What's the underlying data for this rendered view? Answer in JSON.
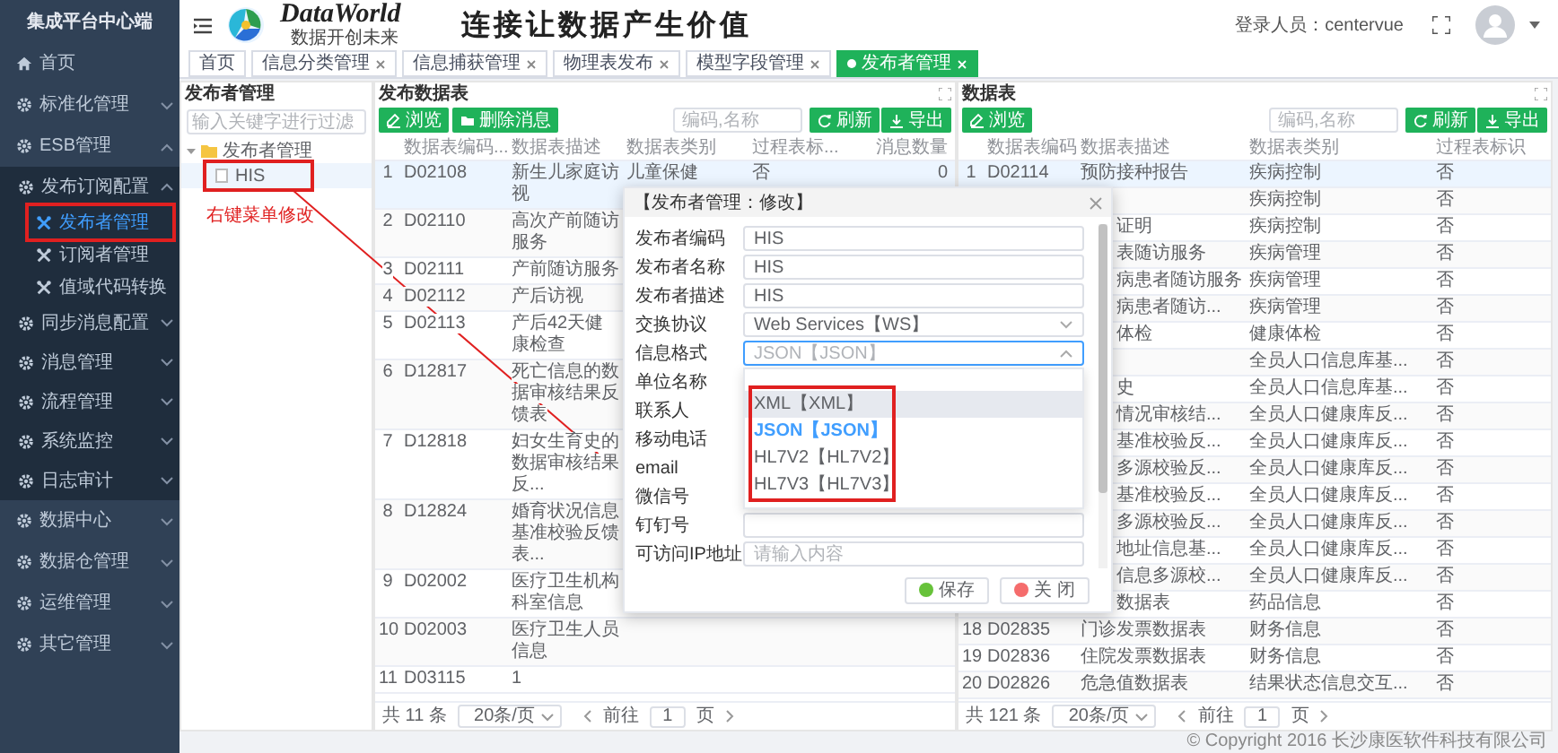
{
  "sidebar": {
    "title": "集成平台中心端",
    "items": [
      {
        "label": "首页"
      },
      {
        "label": "标准化管理",
        "expanded": false
      },
      {
        "label": "ESB管理",
        "expanded": true,
        "children": [
          {
            "label": "发布订阅配置",
            "expanded": true,
            "children": [
              {
                "label": "发布者管理",
                "selected": true,
                "annotated": true
              },
              {
                "label": "订阅者管理",
                "selected": false
              },
              {
                "label": "值域代码转换",
                "selected": false
              }
            ]
          },
          {
            "label": "同步消息配置",
            "expanded": false
          },
          {
            "label": "消息管理",
            "expanded": false
          },
          {
            "label": "流程管理",
            "expanded": false
          },
          {
            "label": "系统监控",
            "expanded": false
          },
          {
            "label": "日志审计",
            "expanded": false
          }
        ]
      },
      {
        "label": "数据中心",
        "expanded": false
      },
      {
        "label": "数据仓管理",
        "expanded": false
      },
      {
        "label": "运维管理",
        "expanded": false
      },
      {
        "label": "其它管理",
        "expanded": false
      }
    ]
  },
  "header": {
    "logo": {
      "name": "DataWorld",
      "tagline": "数据开创未来"
    },
    "slogan": "连接让数据产生价值",
    "user": "登录人员：centervue"
  },
  "tabs": [
    {
      "label": "首页",
      "closable": false,
      "selected": false
    },
    {
      "label": "信息分类管理",
      "closable": true,
      "selected": false
    },
    {
      "label": "信息捕获管理",
      "closable": true,
      "selected": false
    },
    {
      "label": "物理表发布",
      "closable": true,
      "selected": false
    },
    {
      "label": "模型字段管理",
      "closable": true,
      "selected": false
    },
    {
      "label": "发布者管理",
      "closable": true,
      "selected": true
    }
  ],
  "publisher_tree": {
    "title": "发布者管理",
    "filter_placeholder": "输入关键字进行过滤",
    "nodes": [
      {
        "label": "发布者管理",
        "expanded": true,
        "children": [
          {
            "label": "HIS",
            "selected": true,
            "annotated": true
          }
        ]
      }
    ],
    "annotation": {
      "text": "右键菜单修改"
    }
  },
  "publish_tables": {
    "title": "发布数据表",
    "actions": [
      {
        "label": "浏览",
        "kind": "browse"
      },
      {
        "label": "删除消息",
        "kind": "delete"
      }
    ],
    "search_placeholder": "编码,名称",
    "tools": [
      {
        "label": "刷新",
        "kind": "refresh"
      },
      {
        "label": "导出",
        "kind": "export"
      }
    ],
    "columns": [
      "数据表编码...",
      "数据表描述",
      "数据表类别",
      "过程表标...",
      "消息数量"
    ],
    "rows": [
      {
        "index": "1",
        "code": "D02108",
        "desc": "新生儿家庭访视",
        "category": "儿童保健",
        "process": "否",
        "count": "0",
        "selected": true
      },
      {
        "index": "2",
        "code": "D02110",
        "desc": "高次产前随访服务",
        "selected": false
      },
      {
        "index": "3",
        "code": "D02111",
        "desc": "产前随访服务",
        "selected": false
      },
      {
        "index": "4",
        "code": "D02112",
        "desc": "产后访视",
        "selected": false
      },
      {
        "index": "5",
        "code": "D02113",
        "desc": "产后42天健康检查",
        "selected": false
      },
      {
        "index": "6",
        "code": "D12817",
        "desc": "死亡信息的数据审核结果反馈表",
        "selected": false
      },
      {
        "index": "7",
        "code": "D12818",
        "desc": "妇女生育史的数据审核结果反...",
        "selected": false
      },
      {
        "index": "8",
        "code": "D12824",
        "desc": "婚育状况信息基准校验反馈表...",
        "selected": false
      },
      {
        "index": "9",
        "code": "D02002",
        "desc": "医疗卫生机构科室信息",
        "selected": false
      },
      {
        "index": "10",
        "code": "D02003",
        "desc": "医疗卫生人员信息",
        "selected": false
      },
      {
        "index": "11",
        "code": "D03115",
        "desc": "1",
        "selected": false
      }
    ],
    "pager": {
      "total": "共 11 条",
      "page_size": "20条/页",
      "goto": "前往",
      "page": "1",
      "unit": "页"
    }
  },
  "tables": {
    "title": "数据表",
    "actions": [
      {
        "label": "浏览",
        "kind": "browse"
      }
    ],
    "search_placeholder": "编码,名称",
    "tools": [
      {
        "label": "刷新",
        "kind": "refresh"
      },
      {
        "label": "导出",
        "kind": "export"
      }
    ],
    "columns": [
      "数据表编码",
      "数据表描述",
      "数据表类别",
      "过程表标识"
    ],
    "rows": [
      {
        "index": "1",
        "code": "D02114",
        "desc": "预防接种报告",
        "category": "疾病控制",
        "process": "否",
        "selected": true
      },
      {
        "category": "疾病控制",
        "process": "否",
        "selected": false
      },
      {
        "desc": "证明",
        "category": "疾病控制",
        "process": "否",
        "selected": false
      },
      {
        "desc": "表随访服务",
        "category": "疾病管理",
        "process": "否",
        "selected": false
      },
      {
        "desc": "病患者随访服务",
        "category": "疾病管理",
        "process": "否",
        "selected": false
      },
      {
        "desc": "病患者随访...",
        "category": "疾病管理",
        "process": "否",
        "selected": false
      },
      {
        "desc": "体检",
        "category": "健康体检",
        "process": "否",
        "selected": false
      },
      {
        "category": "全员人口信息库基...",
        "process": "否",
        "selected": false
      },
      {
        "desc": "史",
        "category": "全员人口信息库基...",
        "process": "否",
        "selected": false
      },
      {
        "desc": "情况审核结...",
        "category": "全员人口健康库反...",
        "process": "否",
        "selected": false
      },
      {
        "desc": "基准校验反...",
        "category": "全员人口健康库反...",
        "process": "否",
        "selected": false
      },
      {
        "desc": "多源校验反...",
        "category": "全员人口健康库反...",
        "process": "否",
        "selected": false
      },
      {
        "desc": "基准校验反...",
        "category": "全员人口健康库反...",
        "process": "否",
        "selected": false
      },
      {
        "desc": "多源校验反...",
        "category": "全员人口健康库反...",
        "process": "否",
        "selected": false
      },
      {
        "desc": "地址信息基...",
        "category": "全员人口健康库反...",
        "process": "否",
        "selected": false
      },
      {
        "desc": "信息多源校...",
        "category": "全员人口健康库反...",
        "process": "否",
        "selected": false
      },
      {
        "desc": "数据表",
        "category": "药品信息",
        "process": "否",
        "selected": false
      },
      {
        "index": "18",
        "code": "D02835",
        "desc": "门诊发票数据表",
        "category": "财务信息",
        "process": "否",
        "selected": false
      },
      {
        "index": "19",
        "code": "D02836",
        "desc": "住院发票数据表",
        "category": "财务信息",
        "process": "否",
        "selected": false
      },
      {
        "index": "20",
        "code": "D02826",
        "desc": "危急值数据表",
        "category": "结果状态信息交互...",
        "process": "否",
        "selected": false
      }
    ],
    "pager": {
      "total": "共 121 条",
      "page_size": "20条/页",
      "goto": "前往",
      "page": "1",
      "unit": "页"
    }
  },
  "dialog": {
    "title": "【发布者管理：修改】",
    "fields": [
      {
        "label": "发布者编码",
        "kind": "text",
        "value": "HIS"
      },
      {
        "label": "发布者名称",
        "kind": "text",
        "value": "HIS"
      },
      {
        "label": "发布者描述",
        "kind": "text",
        "value": "HIS"
      },
      {
        "label": "交换协议",
        "kind": "select",
        "value": "Web Services【WS】",
        "expanded": false
      },
      {
        "label": "信息格式",
        "kind": "select",
        "placeholder": "JSON【JSON】",
        "expanded": true
      },
      {
        "label": "单位名称",
        "kind": "covered"
      },
      {
        "label": "联系人",
        "kind": "covered"
      },
      {
        "label": "移动电话",
        "kind": "covered"
      },
      {
        "label": "email",
        "kind": "covered"
      },
      {
        "label": "微信号",
        "kind": "covered"
      },
      {
        "label": "钉钉号",
        "kind": "text"
      },
      {
        "label": "可访问IP地址",
        "kind": "text",
        "placeholder": "请输入内容"
      }
    ],
    "dropdown": {
      "annotated": true,
      "options": [
        {
          "label": "XML【XML】",
          "selected": false,
          "hovered": true
        },
        {
          "label": "JSON【JSON】",
          "selected": true,
          "hovered": false
        },
        {
          "label": "HL7V2【HL7V2】",
          "selected": false,
          "hovered": false
        },
        {
          "label": "HL7V3【HL7V3】",
          "selected": false,
          "hovered": false
        }
      ]
    },
    "buttons": [
      {
        "label": "保存",
        "kind": "save"
      },
      {
        "label": "关 闭",
        "kind": "close"
      }
    ]
  },
  "footer": {
    "copyright": "© Copyright 2016 长沙康医软件科技有限公司"
  }
}
